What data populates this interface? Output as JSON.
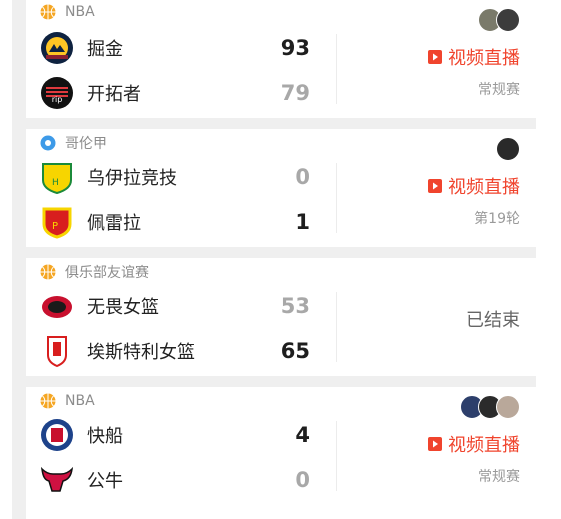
{
  "matches": [
    {
      "league": "NBA",
      "league_icon": "basketball-icon",
      "home": {
        "name": "掘金",
        "score": "93",
        "logo": "nuggets-logo"
      },
      "away": {
        "name": "开拓者",
        "score": "79",
        "logo": "blazers-logo"
      },
      "status": "视频直播",
      "stage": "常规赛"
    },
    {
      "league": "哥伦甲",
      "league_icon": "soccer-ball-icon",
      "home": {
        "name": "乌伊拉竞技",
        "score": "0",
        "logo": "huila-logo"
      },
      "away": {
        "name": "佩雷拉",
        "score": "1",
        "logo": "pereira-logo"
      },
      "status": "视频直播",
      "stage": "第19轮"
    },
    {
      "league": "俱乐部友谊赛",
      "league_icon": "basketball-icon",
      "home": {
        "name": "无畏女篮",
        "score": "53",
        "logo": "team-logo"
      },
      "away": {
        "name": "埃斯特利女篮",
        "score": "65",
        "logo": "team-logo"
      },
      "status": "已结束"
    },
    {
      "league": "NBA",
      "league_icon": "basketball-icon",
      "home": {
        "name": "快船",
        "score": "4",
        "logo": "clippers-logo"
      },
      "away": {
        "name": "公牛",
        "score": "0",
        "logo": "bulls-logo"
      },
      "status": "视频直播",
      "stage": "常规赛"
    }
  ],
  "colors": {
    "live": "#f0442d",
    "winner_score": "#1e1e1e",
    "loser_score": "#a8a8a8"
  }
}
